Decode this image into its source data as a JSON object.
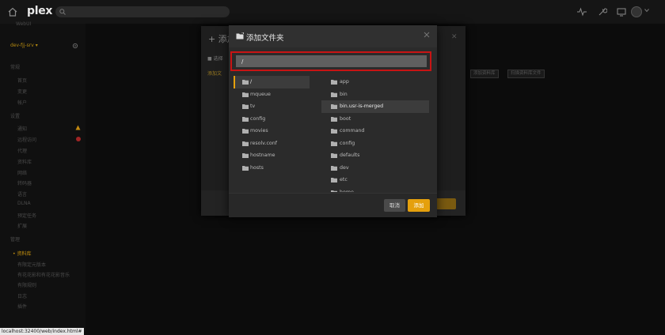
{
  "topbar": {
    "logo": "plex"
  },
  "sidebar": {
    "server_name": "dev-fjj-srv ▾",
    "items": [
      {
        "label": "WebUI"
      },
      {
        "label": "常规"
      },
      {
        "label": "首页"
      },
      {
        "label": "变更"
      },
      {
        "label": "帐户"
      },
      {
        "label": "设置"
      },
      {
        "label": "通知"
      },
      {
        "label": "远程访问"
      },
      {
        "label": "代理"
      },
      {
        "label": "资料库"
      },
      {
        "label": "网络"
      },
      {
        "label": "转码器"
      },
      {
        "label": "语言"
      },
      {
        "label": "DLNA"
      },
      {
        "label": "预定任务"
      },
      {
        "label": "扩展"
      },
      {
        "label": "管理"
      },
      {
        "label": "• 资料库"
      },
      {
        "label": "有限定元版本"
      },
      {
        "label": "有花花影和有花花影音乐"
      },
      {
        "label": "有限规则"
      },
      {
        "label": "日志"
      },
      {
        "label": "插件"
      }
    ]
  },
  "background_dialog": {
    "title": "+ 添加",
    "row1": "■ 选择",
    "row2": "添加文",
    "chip1": "添加资料库",
    "chip2": "扫描资料库文件"
  },
  "folder_dialog": {
    "title": "添加文件夹",
    "path_value": "/",
    "left_items": [
      {
        "label": "/",
        "selected": true
      },
      {
        "label": "mqueue"
      },
      {
        "label": "tv"
      },
      {
        "label": "config"
      },
      {
        "label": "movies"
      },
      {
        "label": "resolv.conf"
      },
      {
        "label": "hostname"
      },
      {
        "label": "hosts"
      }
    ],
    "right_items": [
      {
        "label": "app"
      },
      {
        "label": "bin"
      },
      {
        "label": "bin.usr-is-merged",
        "selected": true
      },
      {
        "label": "boot"
      },
      {
        "label": "command"
      },
      {
        "label": "config"
      },
      {
        "label": "defaults"
      },
      {
        "label": "dev"
      },
      {
        "label": "etc"
      },
      {
        "label": "home"
      }
    ],
    "cancel_label": "取消",
    "add_label": "添加",
    "accent_color": "#e5a00d",
    "highlight_color": "#c81414"
  },
  "statusbar": {
    "url": "localhost:32400/web/index.html#"
  }
}
